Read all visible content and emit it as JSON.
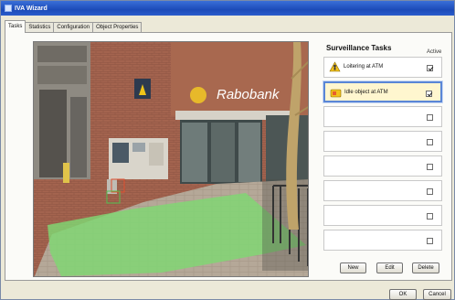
{
  "window": {
    "title": "IVA Wizard"
  },
  "tabs": [
    {
      "label": "Tasks",
      "active": true
    },
    {
      "label": "Statistics",
      "active": false
    },
    {
      "label": "Configuration",
      "active": false
    },
    {
      "label": "Object Properties",
      "active": false
    }
  ],
  "camera": {
    "sign_text": "Rabobank"
  },
  "tasks": {
    "title": "Surveillance Tasks",
    "active_header": "Active",
    "items": [
      {
        "label": "Loitering at ATM",
        "icon": "person-warning-icon",
        "checked": true,
        "selected": false
      },
      {
        "label": "Idle object at ATM",
        "icon": "idle-object-icon",
        "checked": true,
        "selected": true
      },
      {
        "label": "",
        "checked": false,
        "selected": false
      },
      {
        "label": "",
        "checked": false,
        "selected": false
      },
      {
        "label": "",
        "checked": false,
        "selected": false
      },
      {
        "label": "",
        "checked": false,
        "selected": false
      },
      {
        "label": "",
        "checked": false,
        "selected": false
      },
      {
        "label": "",
        "checked": false,
        "selected": false
      }
    ]
  },
  "buttons": {
    "new": "New",
    "edit": "Edit",
    "delete": "Delete",
    "ok": "OK",
    "cancel": "Cancel"
  }
}
